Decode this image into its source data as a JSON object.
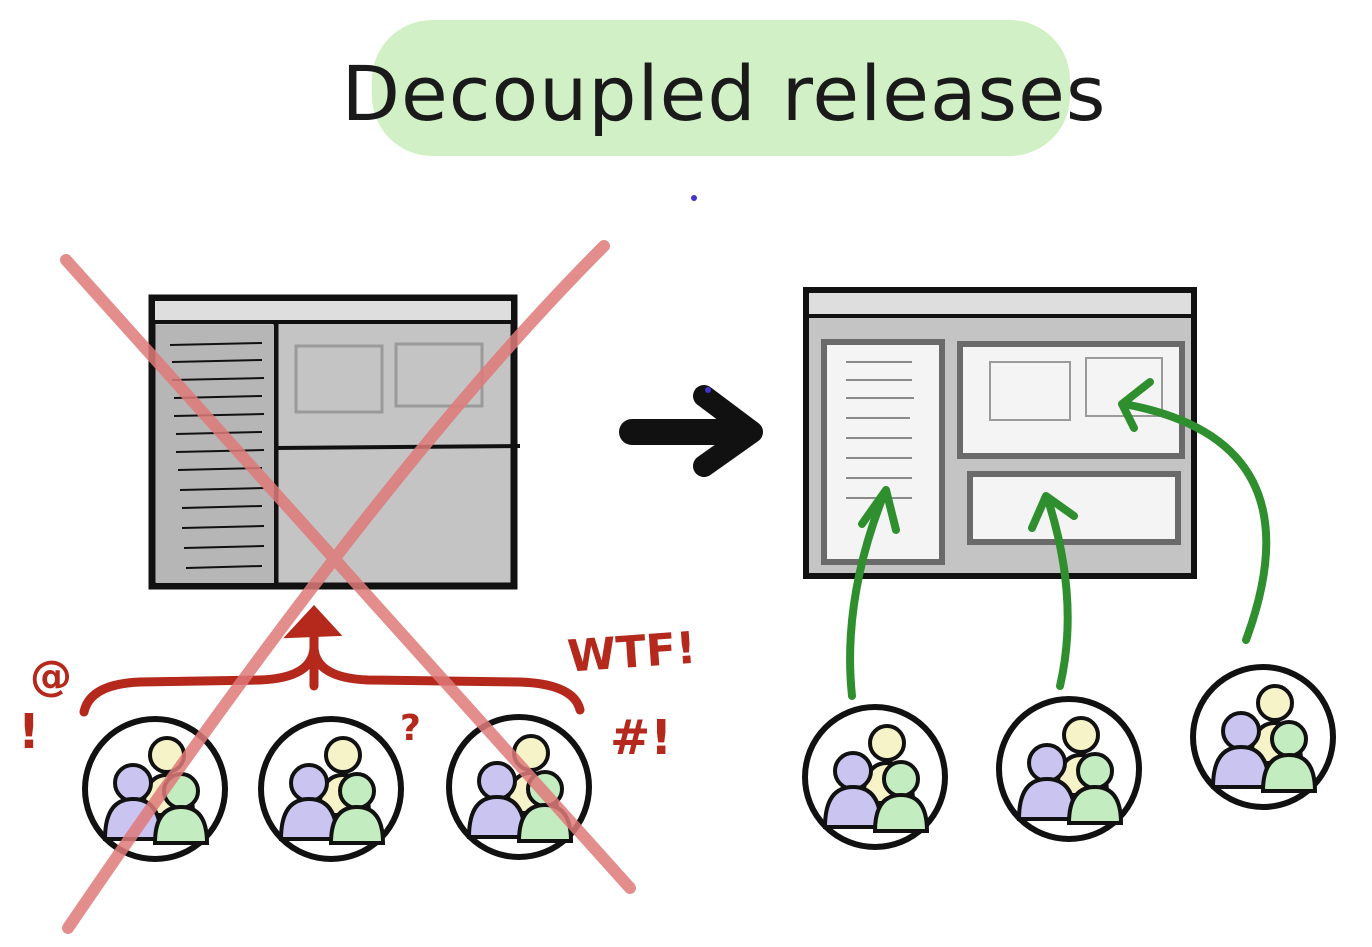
{
  "title": "Decoupled releases",
  "left_panel": {
    "state": "rejected",
    "expletives": [
      "WTF!",
      "#!",
      "?",
      "!",
      "@"
    ]
  },
  "right_panel": {
    "state": "preferred"
  },
  "colors": {
    "title_highlight": "#cdeec0",
    "cross": "#e07a7a",
    "tangle_arrow": "#b5281c",
    "deploy_arrow": "#2f8f2f",
    "person_yellow": "#f7f3c8",
    "person_purple": "#c9c4f0",
    "person_green": "#c3ecc0",
    "app_gray": "#c8c8c8"
  },
  "icons": [
    "big-arrow-right-icon",
    "cross-out-icon",
    "team-icon"
  ]
}
